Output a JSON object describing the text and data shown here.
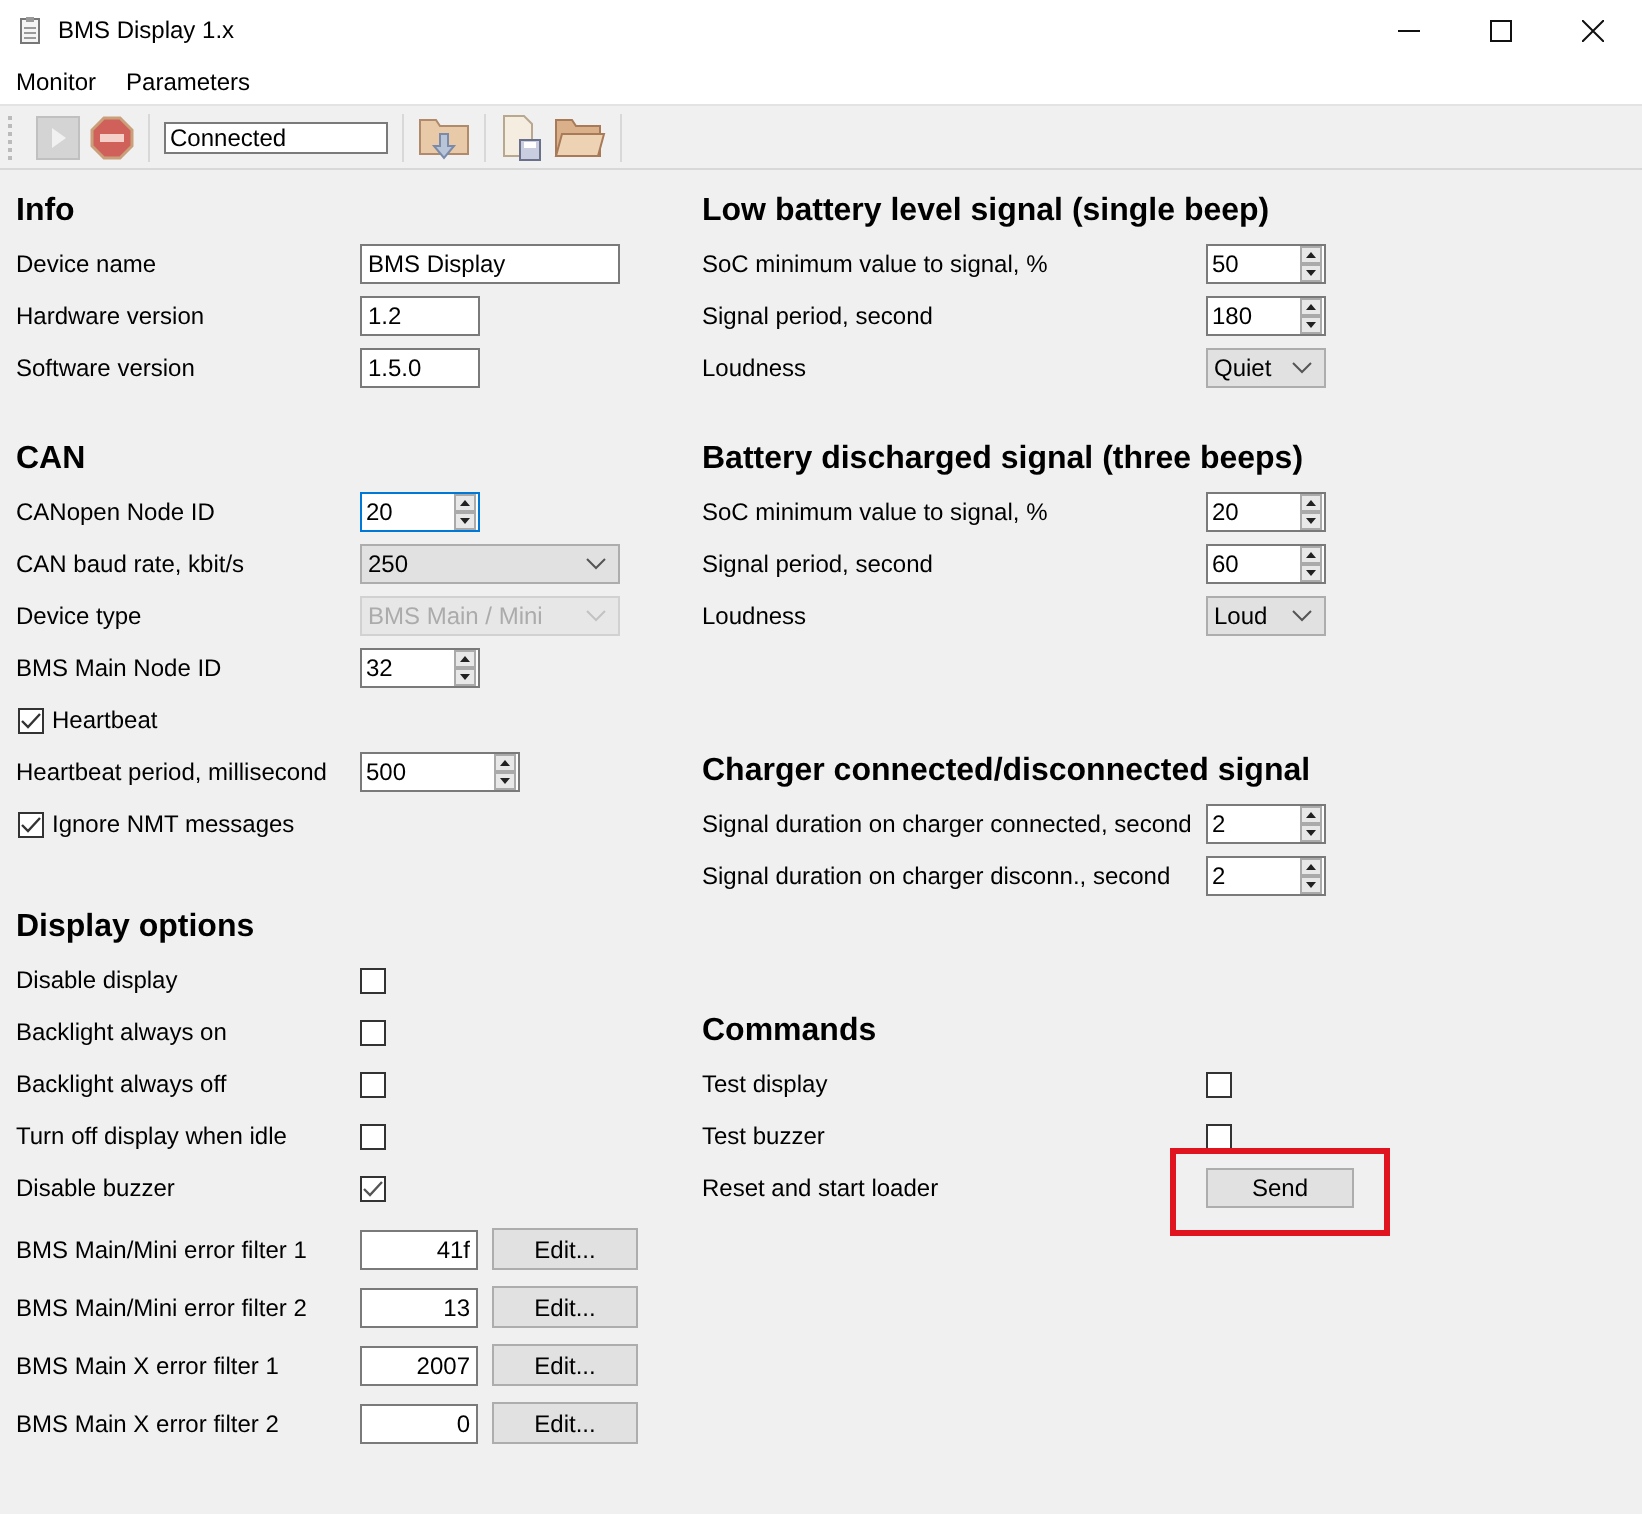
{
  "window": {
    "title": "BMS Display 1.x"
  },
  "menu": [
    "Monitor",
    "Parameters"
  ],
  "toolbar": [
    {
      "kind": "play",
      "disabled": true
    },
    {
      "kind": "stop",
      "disabled": false
    },
    {
      "kind": "status",
      "value": "Connected"
    },
    {
      "kind": "load",
      "disabled": false
    },
    {
      "kind": "save",
      "disabled": false
    },
    {
      "kind": "open",
      "disabled": false
    }
  ],
  "left_sections": [
    {
      "title": "Info",
      "rows": [
        {
          "kind": "text",
          "label": "Device name",
          "value": "BMS Display"
        },
        {
          "kind": "text",
          "label": "Hardware version",
          "value": "1.2"
        },
        {
          "kind": "text",
          "label": "Software version",
          "value": "1.5.0"
        }
      ]
    },
    {
      "title": "CAN",
      "rows": [
        {
          "kind": "spin",
          "label": "CANopen Node ID",
          "value": "20",
          "focused": true
        },
        {
          "kind": "combo",
          "label": "CAN baud rate, kbit/s",
          "value": "250",
          "disabled": false
        },
        {
          "kind": "combo",
          "label": "Device type",
          "value": "BMS Main / Mini",
          "disabled": true
        },
        {
          "kind": "spin",
          "label": "BMS Main Node ID",
          "value": "32",
          "focused": false
        },
        {
          "kind": "checkline",
          "label": "Heartbeat",
          "checked": true
        },
        {
          "kind": "spin",
          "label": "Heartbeat period, millisecond",
          "value": "500",
          "focused": false
        },
        {
          "kind": "checkline",
          "label": "Ignore NMT messages",
          "checked": true
        }
      ]
    },
    {
      "title": "Display options",
      "rows": [
        {
          "kind": "check",
          "label": "Disable display",
          "checked": false
        },
        {
          "kind": "check",
          "label": "Backlight always on",
          "checked": false
        },
        {
          "kind": "check",
          "label": "Backlight always off",
          "checked": false
        },
        {
          "kind": "check",
          "label": "Turn off display when idle",
          "checked": false
        },
        {
          "kind": "check",
          "label": "Disable buzzer",
          "checked": true
        },
        {
          "kind": "hex",
          "label": "BMS Main/Mini error filter 1",
          "value": "41f",
          "button": "Edit..."
        },
        {
          "kind": "hex",
          "label": "BMS Main/Mini error filter 2",
          "value": "13",
          "button": "Edit..."
        },
        {
          "kind": "hex",
          "label": "BMS Main X error filter 1",
          "value": "2007",
          "button": "Edit..."
        },
        {
          "kind": "hex",
          "label": "BMS Main X error filter 2",
          "value": "0",
          "button": "Edit..."
        }
      ]
    }
  ],
  "right_sections": [
    {
      "title": "Low battery level signal (single beep)",
      "rows": [
        {
          "kind": "spin",
          "label": "SoC minimum value to signal, %",
          "value": "50",
          "focused": false
        },
        {
          "kind": "spin",
          "label": "Signal period, second",
          "value": "180",
          "focused": false
        },
        {
          "kind": "combo",
          "label": "Loudness",
          "value": "Quiet",
          "disabled": false
        }
      ]
    },
    {
      "title": "Battery discharged signal (three beeps)",
      "rows": [
        {
          "kind": "spin",
          "label": "SoC minimum value to signal, %",
          "value": "20",
          "focused": false
        },
        {
          "kind": "spin",
          "label": "Signal period, second",
          "value": "60",
          "focused": false
        },
        {
          "kind": "combo",
          "label": "Loudness",
          "value": "Loud",
          "disabled": false
        }
      ]
    },
    {
      "title": "Charger connected/disconnected signal",
      "rows": [
        {
          "kind": "spin",
          "label": "Signal duration on charger connected, second",
          "value": "2",
          "focused": false
        },
        {
          "kind": "spin",
          "label": "Signal duration on charger disconn., second",
          "value": "2",
          "focused": false
        }
      ]
    },
    {
      "title": "Commands",
      "rows": [
        {
          "kind": "check",
          "label": "Test display",
          "checked": false
        },
        {
          "kind": "check",
          "label": "Test buzzer",
          "checked": false
        },
        {
          "kind": "button",
          "label": "Reset and start loader",
          "button": "Send",
          "highlighted": true
        }
      ]
    }
  ]
}
